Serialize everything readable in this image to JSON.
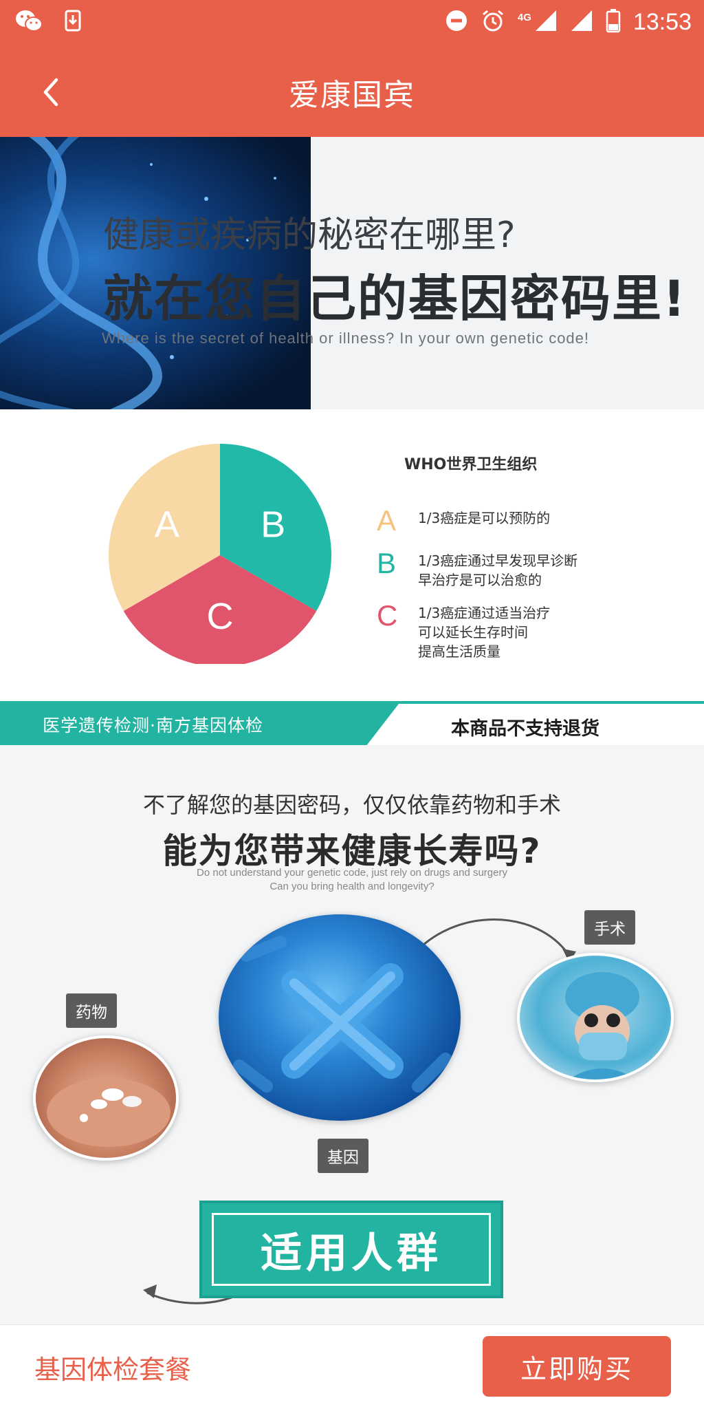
{
  "status_bar": {
    "time": "13:53",
    "network": "4G",
    "icons": [
      "wechat-icon",
      "download-icon",
      "do-not-disturb-icon",
      "alarm-icon",
      "signal-icon",
      "battery-icon"
    ]
  },
  "header": {
    "title": "爱康国宾",
    "back_icon": "back-arrow-icon"
  },
  "banner": {
    "line1": "健康或疾病的秘密在哪里?",
    "line2": "就在您自己的基因密码里!",
    "line3": "Where is the secret of health or illness? In your own genetic code!"
  },
  "pie_section": {
    "title": "WHO世界卫生组织",
    "slices": [
      {
        "label": "A",
        "fraction": 0.3333,
        "color": "#f8d9a6"
      },
      {
        "label": "B",
        "fraction": 0.3333,
        "color": "#22b9a9"
      },
      {
        "label": "C",
        "fraction": 0.3333,
        "color": "#e0546c"
      }
    ],
    "legend": [
      {
        "letter": "A",
        "text": "1/3癌症是可以预防的",
        "color": "#f5c37d"
      },
      {
        "letter": "B",
        "text": "1/3癌症通过早发现早诊断\n早治疗是可以治愈的",
        "color": "#22b3a1"
      },
      {
        "letter": "C",
        "text": "1/3癌症通过适当治疗\n可以延长生存时间\n提高生活质量",
        "color": "#e0546c"
      }
    ]
  },
  "band": {
    "left_text": "医学遗传检测·南方基因体检",
    "right_text": "本商品不支持退货"
  },
  "question": {
    "line1": "不了解您的基因密码，仅仅依靠药物和手术",
    "line2": "能为您带来健康长寿吗?",
    "en_line1": "Do not understand your genetic code, just rely on drugs and surgery",
    "en_line2": "Can you bring health and longevity?"
  },
  "illustration": {
    "surgery_label": "手术",
    "medicine_label": "药物",
    "gene_label": "基因"
  },
  "suitable_label": "适用人群",
  "bottom_bar": {
    "package_label": "基因体检套餐",
    "buy_label": "立即购买"
  }
}
